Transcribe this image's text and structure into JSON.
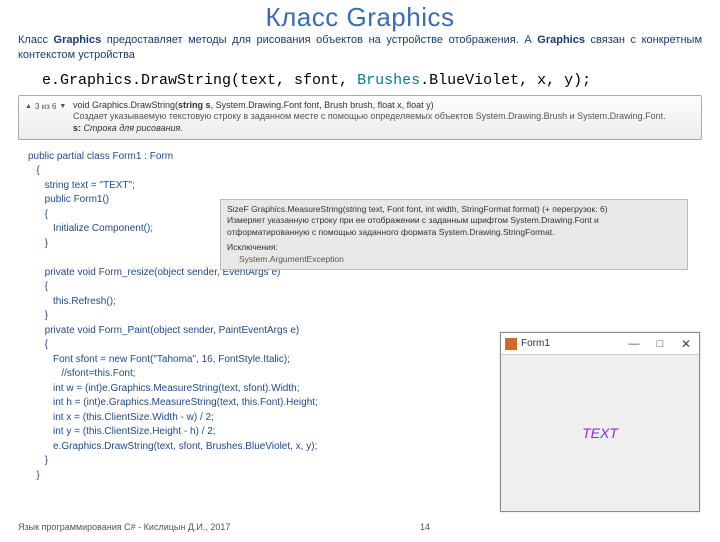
{
  "title": "Класс Graphics",
  "description_html": "Класс <b>Graphics</b> предоставляет методы для рисования объектов на устройстве отображения. А <b>Graphics</b> связан с конкретным контекстом устройства",
  "code_bar": {
    "prefix": "e.Graphics.DrawString(text, sfont, ",
    "brush": "Brushes",
    "suffix": ".BlueViolet, x, y);"
  },
  "tooltip1": {
    "nav": "3 из 6",
    "sig_pre": "void Graphics.DrawString(",
    "sig_bold": "string s",
    "sig_post": ", System.Drawing.Font font, Brush brush, float x, float y)",
    "tdesc": "Создает указываемую текстовую строку в заданном месте с помощью определяемых объектов System.Drawing.Brush и System.Drawing.Font.",
    "param_label": "s:",
    "param_desc": "Строка для рисования."
  },
  "code": "public partial class Form1 : Form\n   {\n      string text = \"TEXT\";\n      public Form1()\n      {\n         Initialize Component();\n      }\n\n      private void Form_resize(object sender, EventArgs e)\n      {\n         this.Refresh();\n      }\n      private void Form_Paint(object sender, PaintEventArgs e)\n      {\n         Font sfont = new Font(\"Tahoma\", 16, FontStyle.Italic);\n            //sfont=this.Font;\n         int w = (int)e.Graphics.MeasureString(text, sfont).Width;\n         int h = (int)e.Graphics.MeasureString(text, this.Font).Height;\n         int x = (this.ClientSize.Width - w) / 2;\n         int y = (this.ClientSize.Height - h) / 2;\n         e.Graphics.DrawString(text, sfont, Brushes.BlueViolet, x, y);\n      }\n   }",
  "tooltip2": {
    "sig": "SizeF Graphics.MeasureString(string text, Font font, int width, StringFormat format) (+ перегрузок: 6)",
    "desc": "Измеряет указанную строку при ее отображении с заданным шрифтом System.Drawing.Font и отформатированную с помощью заданного формата System.Drawing.StringFormat.",
    "exc_label": "Исключения:",
    "exc_val": "System.ArgumentException"
  },
  "window": {
    "title": "Form1",
    "min": "—",
    "max": "□",
    "close": "✕",
    "text": "TEXT"
  },
  "footer": "Язык программирования C# - Кислицын Д.И., 2017",
  "page": "14"
}
